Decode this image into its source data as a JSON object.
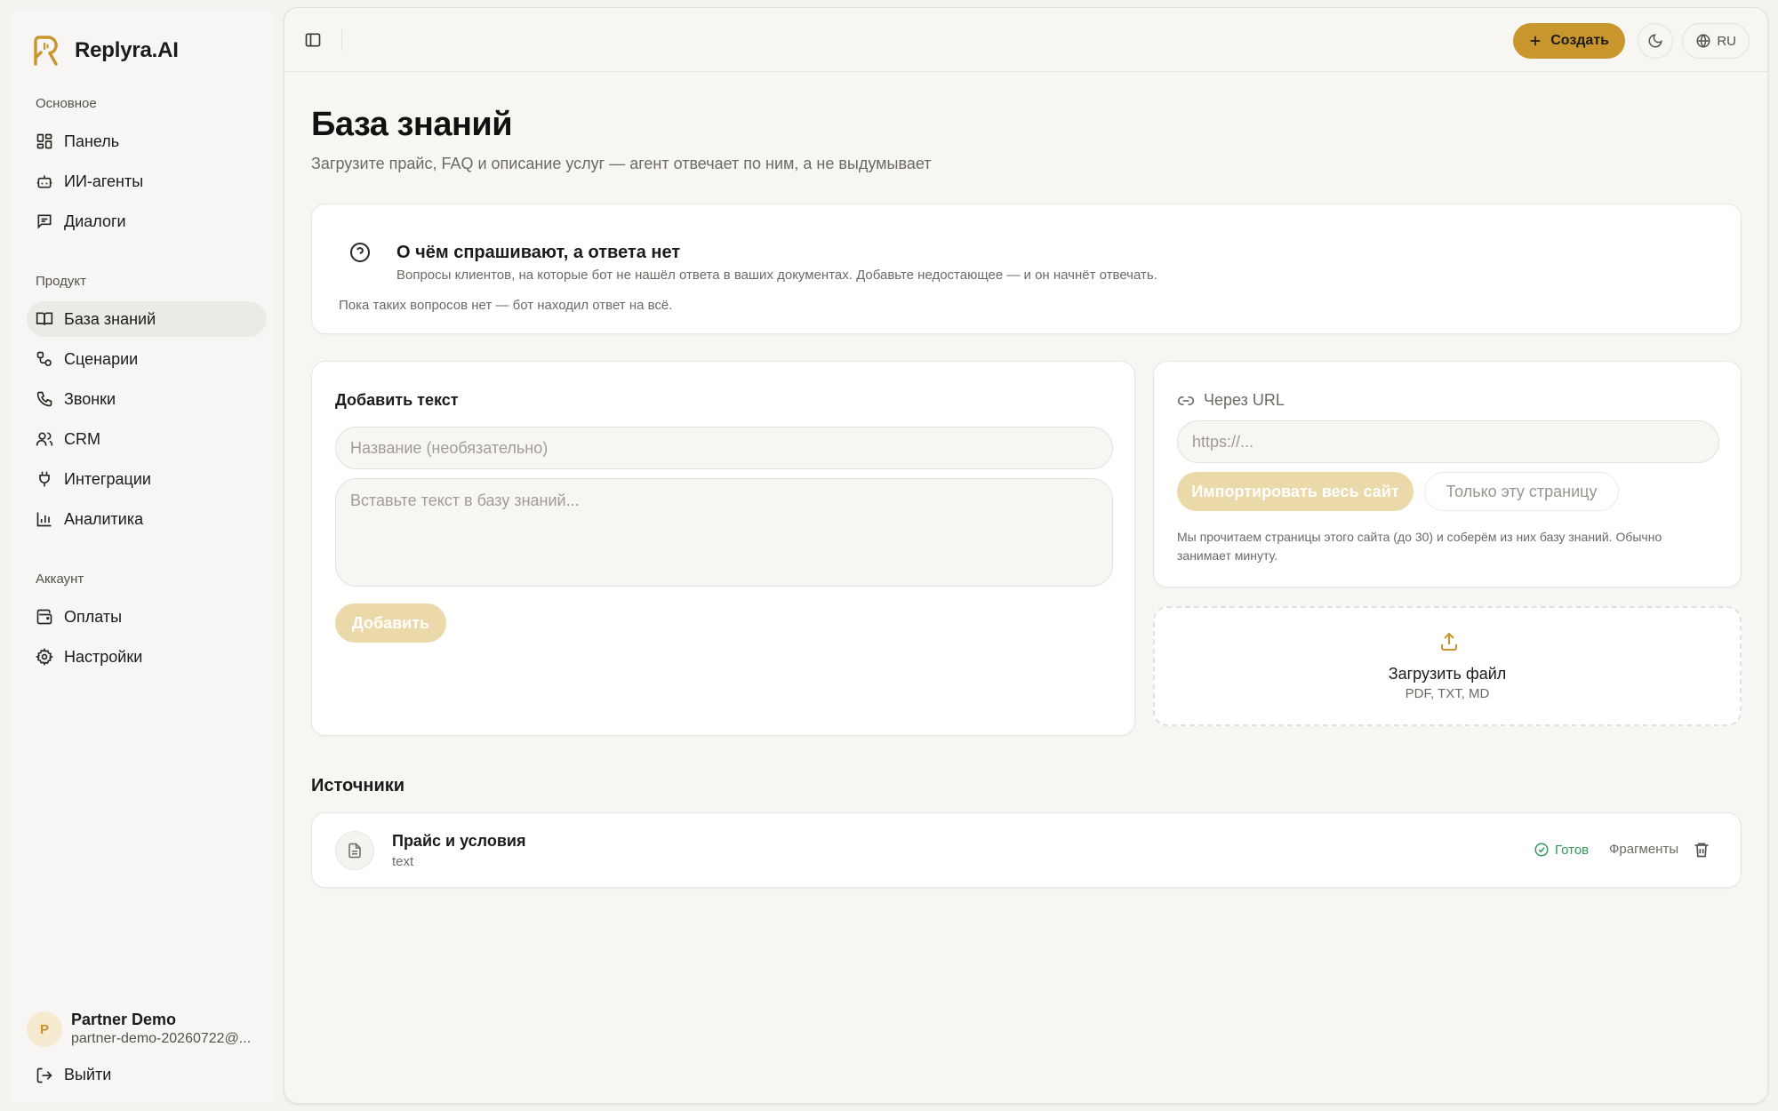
{
  "brand": {
    "name": "Replyra.AI",
    "logo_icon": "replyra-logo-icon",
    "accent": "#c9962d"
  },
  "sidebar": {
    "sections": [
      {
        "title": "Основное",
        "items": [
          {
            "label": "Панель",
            "icon": "dashboard-icon"
          },
          {
            "label": "ИИ-агенты",
            "icon": "bot-icon"
          },
          {
            "label": "Диалоги",
            "icon": "chat-icon"
          }
        ]
      },
      {
        "title": "Продукт",
        "items": [
          {
            "label": "База знаний",
            "icon": "book-icon",
            "active": true
          },
          {
            "label": "Сценарии",
            "icon": "workflow-icon"
          },
          {
            "label": "Звонки",
            "icon": "phone-icon"
          },
          {
            "label": "CRM",
            "icon": "users-icon"
          },
          {
            "label": "Интеграции",
            "icon": "plug-icon"
          },
          {
            "label": "Аналитика",
            "icon": "bar-chart-icon"
          }
        ]
      },
      {
        "title": "Аккаунт",
        "items": [
          {
            "label": "Оплаты",
            "icon": "wallet-icon"
          },
          {
            "label": "Настройки",
            "icon": "gear-icon"
          }
        ]
      }
    ],
    "user": {
      "initial": "P",
      "name": "Partner Demo",
      "email": "partner-demo-20260722@..."
    },
    "logout_label": "Выйти"
  },
  "topbar": {
    "create_label": "Создать",
    "lang_label": "RU"
  },
  "page": {
    "title": "База знаний",
    "subtitle": "Загрузите прайс, FAQ и описание услуг — агент отвечает по ним, а не выдумывает"
  },
  "unanswered": {
    "title": "О чём спрашивают, а ответа нет",
    "description": "Вопросы клиентов, на которые бот не нашёл ответа в ваших документах. Добавьте недостающее — и он начнёт отвечать.",
    "empty_text": "Пока таких вопросов нет — бот находил ответ на всё."
  },
  "add_text": {
    "heading": "Добавить текст",
    "title_placeholder": "Название (необязательно)",
    "text_placeholder": "Вставьте текст в базу знаний...",
    "add_label": "Добавить"
  },
  "url_import": {
    "heading": "Через URL",
    "placeholder": "https://...",
    "import_site_label": "Импортировать весь сайт",
    "only_page_label": "Только эту страницу",
    "note": "Мы прочитаем страницы этого сайта (до 30) и соберём из них базу знаний. Обычно занимает минуту."
  },
  "upload": {
    "title": "Загрузить файл",
    "formats": "PDF, TXT, MD"
  },
  "sources": {
    "title": "Источники",
    "items": [
      {
        "name": "Прайс и условия",
        "type": "text",
        "status": "Готов",
        "fragments_label": "Фрагменты",
        "status_color": "#2f9a59"
      }
    ]
  }
}
